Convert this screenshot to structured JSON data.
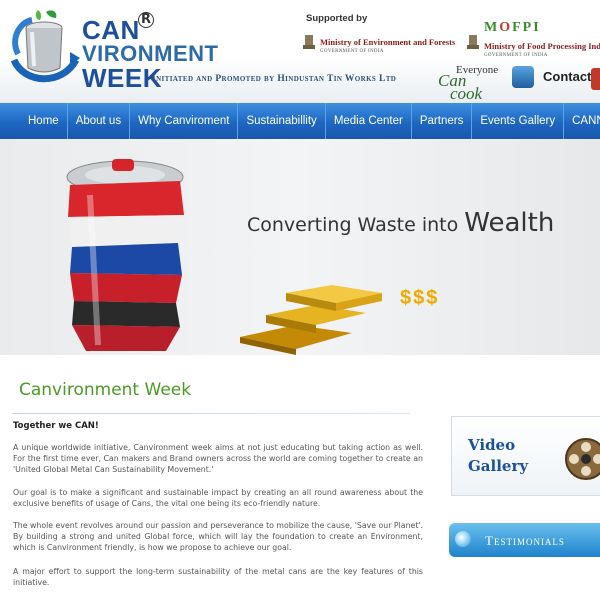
{
  "header": {
    "logo": {
      "line1": "CAN",
      "line2": "VIRONMENT",
      "line3": "WEEK",
      "registered": "R"
    },
    "tagline": "Initiated and Promoted by Hindustan Tin Works Ltd",
    "supported_by": "Supported by",
    "ministry_env": {
      "name": "Ministry of Environment and Forests",
      "sub": "GOVERNMENT OF INDIA"
    },
    "ministry_food": {
      "acronym_letters": [
        "M",
        "O",
        "F",
        "P",
        "I"
      ],
      "name": "Ministry of Food Processing Industries",
      "sub": "GOVERNMENT OF INDIA"
    },
    "everyone_can_cook": {
      "line1": "Everyone",
      "line2": "Can",
      "line3": "cook"
    },
    "contact_label": "Contact"
  },
  "nav": {
    "items": [
      "Home",
      "About us",
      "Why Canviroment",
      "Sustainabillity",
      "Media Center",
      "Partners",
      "Events Gallery",
      "CANNect-Post yo"
    ]
  },
  "banner": {
    "title_part1": "Converting Waste into ",
    "title_part2": "Wealth",
    "dollars": "$$$"
  },
  "main": {
    "title": "Canvironment Week",
    "intro": "Together we CAN!",
    "paragraphs": [
      "A unique worldwide initiative, Canvironment week aims at not just educating but taking action as well. For the first time ever, Can makers and Brand owners across the world are coming together to create an 'United Global Metal Can Sustainability Movement.'",
      "Our goal is to make a significant and sustainable impact by creating an all round awareness about the exclusive benefits of usage of Cans, the vital one being its eco-friendly nature.",
      "The whole event revolves around our passion and perseverance to mobilize the cause, 'Save our Planet'. By building a strong and united Global force, which will lay the foundation to create an Environment, which is Canvironment friendly, is how we propose to achieve our goal.",
      "A major effort to support the long-term sustainability of the metal cans are the key features of this initiative."
    ]
  },
  "sidebar": {
    "video_gallery": {
      "line1": "Video",
      "line2": "Gallery"
    },
    "testimonials": "Testimonials"
  },
  "colors": {
    "nav_blue": "#1e67c2",
    "title_green": "#4a9a24",
    "logo_blue": "#1d4f9c"
  }
}
